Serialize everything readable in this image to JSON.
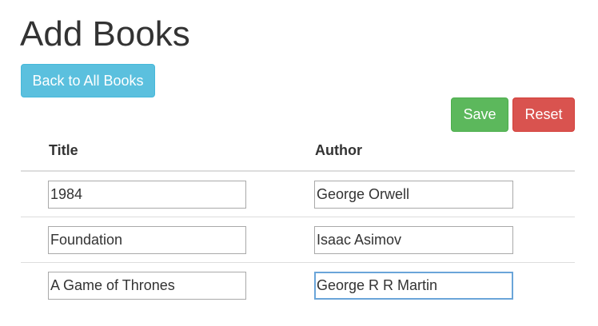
{
  "page": {
    "title": "Add Books"
  },
  "actions": {
    "back_label": "Back to All Books",
    "save_label": "Save",
    "reset_label": "Reset"
  },
  "table": {
    "headers": {
      "title": "Title",
      "author": "Author"
    },
    "rows": [
      {
        "title": "1984",
        "author": "George Orwell"
      },
      {
        "title": "Foundation",
        "author": "Isaac Asimov"
      },
      {
        "title": "A Game of Thrones",
        "author": "George R R Martin"
      }
    ]
  },
  "colors": {
    "info": "#5bc0de",
    "success": "#5cb85c",
    "danger": "#d9534f",
    "focus": "#6aa5d9"
  }
}
